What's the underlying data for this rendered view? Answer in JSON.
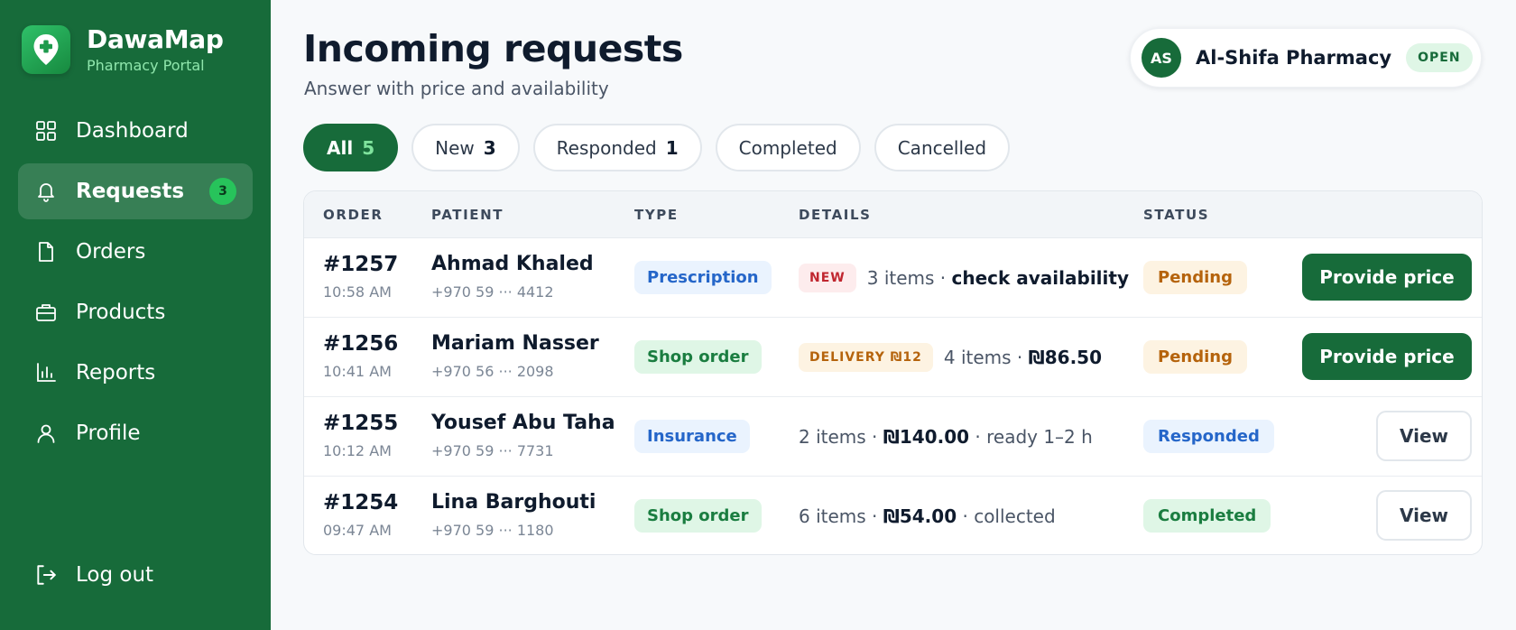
{
  "brand": {
    "name": "DawaMap",
    "subtitle": "Pharmacy Portal"
  },
  "nav": [
    {
      "label": "Dashboard",
      "icon": "grid-icon"
    },
    {
      "label": "Requests",
      "icon": "bell-icon",
      "badge": "3",
      "active": true
    },
    {
      "label": "Orders",
      "icon": "file-icon"
    },
    {
      "label": "Products",
      "icon": "briefcase-icon"
    },
    {
      "label": "Reports",
      "icon": "bar-chart-icon"
    },
    {
      "label": "Profile",
      "icon": "user-icon"
    }
  ],
  "logout": "Log out",
  "header": {
    "title": "Incoming requests",
    "subtitle": "Answer with price and availability"
  },
  "pharmacy": {
    "initials": "AS",
    "name": "Al-Shifa Pharmacy",
    "status": "OPEN"
  },
  "tabs": [
    {
      "label": "All",
      "count": "5"
    },
    {
      "label": "New",
      "count": "3"
    },
    {
      "label": "Responded",
      "count": "1"
    },
    {
      "label": "Completed",
      "count": ""
    },
    {
      "label": "Cancelled",
      "count": ""
    }
  ],
  "table": {
    "columns": [
      "ORDER",
      "PATIENT",
      "TYPE",
      "DETAILS",
      "STATUS"
    ],
    "rows": [
      {
        "order": "#1257",
        "time": "10:58 AM",
        "patient": "Ahmad Khaled",
        "phone": "+970 59 ··· 4412",
        "type": "Prescription",
        "tag": "NEW",
        "details_pre": "3 items · ",
        "details_bold": "check availability",
        "details_post": "",
        "status": "Pending",
        "action": "Provide price"
      },
      {
        "order": "#1256",
        "time": "10:41 AM",
        "patient": "Mariam Nasser",
        "phone": "+970 56 ··· 2098",
        "type": "Shop order",
        "tag": "DELIVERY ₪12",
        "details_pre": "4 items · ",
        "details_bold": "₪86.50",
        "details_post": "",
        "status": "Pending",
        "action": "Provide price"
      },
      {
        "order": "#1255",
        "time": "10:12 AM",
        "patient": "Yousef Abu Taha",
        "phone": "+970 59 ··· 7731",
        "type": "Insurance",
        "tag": "",
        "details_pre": "2 items · ",
        "details_bold": "₪140.00",
        "details_post": " · ready 1–2 h",
        "status": "Responded",
        "action": "View"
      },
      {
        "order": "#1254",
        "time": "09:47 AM",
        "patient": "Lina Barghouti",
        "phone": "+970 59 ··· 1180",
        "type": "Shop order",
        "tag": "",
        "details_pre": "6 items · ",
        "details_bold": "₪54.00",
        "details_post": " · collected",
        "status": "Completed",
        "action": "View"
      }
    ]
  },
  "colors": {
    "brand": "#176b3a",
    "accent": "#27c35b",
    "pending": "#b5630c",
    "responded": "#2566c9",
    "completed": "#1a7d40",
    "new": "#c0262f"
  }
}
